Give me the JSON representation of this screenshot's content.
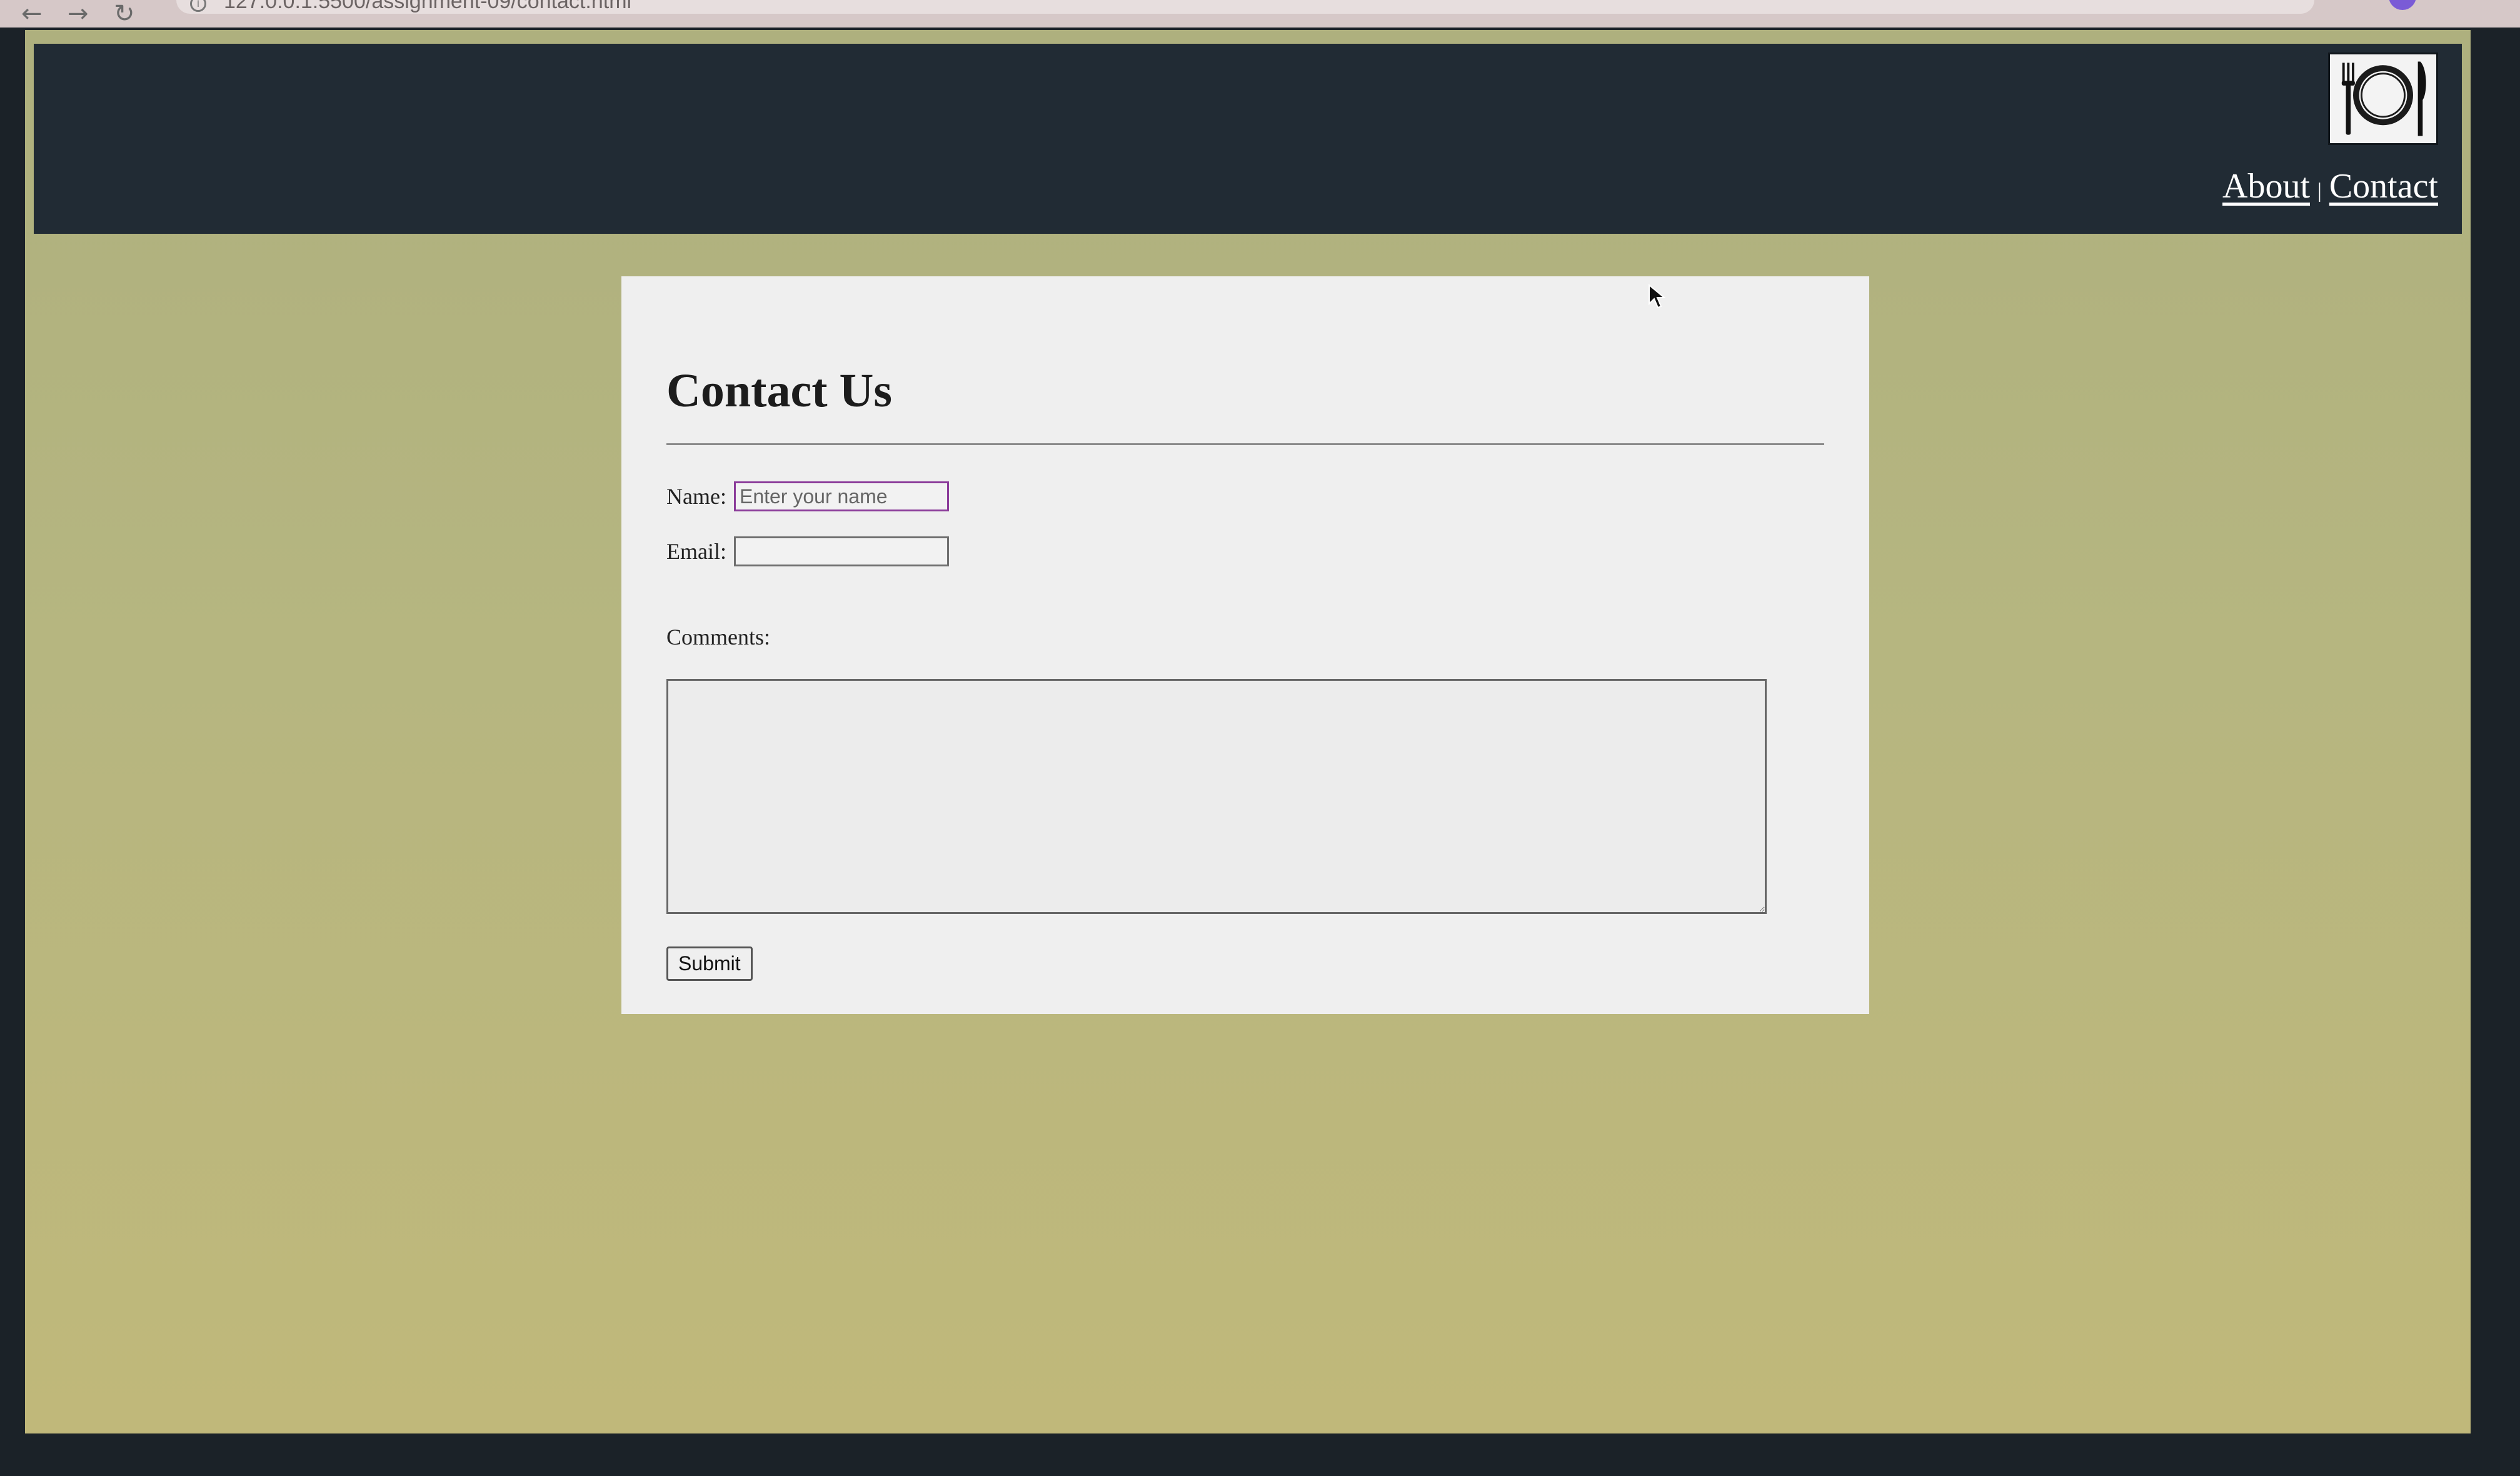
{
  "browser": {
    "back_icon": "←",
    "forward_icon": "→",
    "reload_icon": "↻",
    "info_icon": "i",
    "url": "127.0.0.1:5500/assignment-09/contact.html"
  },
  "site": {
    "logo_icon": "plate-fork-knife-icon",
    "nav": {
      "about": "About",
      "separator": "|",
      "contact": "Contact"
    }
  },
  "form": {
    "title": "Contact Us",
    "name_label": "Name:",
    "name_placeholder": "Enter your name",
    "name_value": "",
    "email_label": "Email:",
    "email_value": "",
    "comments_label": "Comments:",
    "comments_value": "",
    "submit_label": "Submit"
  },
  "colors": {
    "header_bg": "#212b34",
    "page_bg": "#b6b680",
    "card_bg": "#efefef",
    "focus_ring": "#8b3c9a"
  }
}
